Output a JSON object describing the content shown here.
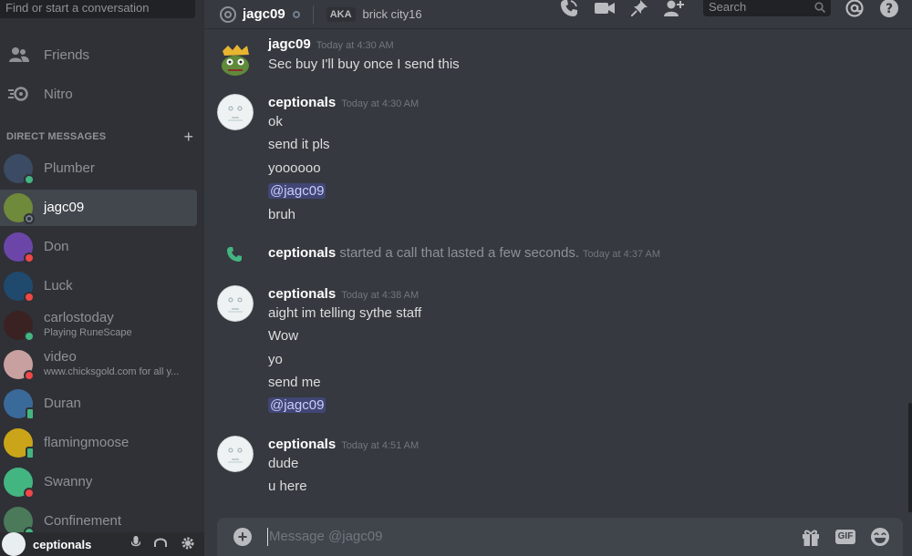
{
  "sidebar": {
    "search_placeholder": "Find or start a conversation",
    "nav": [
      {
        "label": "Friends",
        "icon": "friends-icon"
      },
      {
        "label": "Nitro",
        "icon": "nitro-icon"
      }
    ],
    "dm_header": "DIRECT MESSAGES",
    "dm_add_icon": "plus-icon",
    "dms": [
      {
        "name": "Plumber",
        "sub": "",
        "status": "online",
        "avatar_color": "#3b4b63",
        "active": false
      },
      {
        "name": "jagc09",
        "sub": "",
        "status": "offline",
        "avatar_color": "#6e8a3a",
        "active": true
      },
      {
        "name": "Don",
        "sub": "",
        "status": "dnd",
        "avatar_color": "#6b46a8",
        "active": false
      },
      {
        "name": "Luck",
        "sub": "",
        "status": "dnd",
        "avatar_color": "#1f4a6e",
        "active": false
      },
      {
        "name": "carlostoday",
        "sub": "Playing RuneScape",
        "status": "online",
        "avatar_color": "#3a2222",
        "active": false
      },
      {
        "name": "video",
        "sub": "www.chicksgold.com for all y...",
        "status": "dnd",
        "avatar_color": "#c9a0a0",
        "active": false
      },
      {
        "name": "Duran",
        "sub": "",
        "status": "mobile",
        "avatar_color": "#3a6a9a",
        "active": false
      },
      {
        "name": "flamingmoose",
        "sub": "",
        "status": "mobile",
        "avatar_color": "#caa51a",
        "active": false
      },
      {
        "name": "Swanny",
        "sub": "",
        "status": "dnd",
        "avatar_color": "#43b581",
        "active": false
      },
      {
        "name": "Confinement",
        "sub": "",
        "status": "online",
        "avatar_color": "#4a7a5a",
        "active": false
      }
    ],
    "user_panel": {
      "username": "ceptionals"
    }
  },
  "header": {
    "channel_name": "jagc09",
    "aka_label": "AKA",
    "aka_name": "brick city16",
    "search_placeholder": "Search"
  },
  "messages": {
    "groups": [
      {
        "author": "jagc09",
        "timestamp": "Today at 4:30 AM",
        "lines": [
          "Sec buy I'll buy once I send this"
        ]
      },
      {
        "author": "ceptionals",
        "timestamp": "Today at 4:30 AM",
        "lines": [
          "ok",
          "send it pls",
          "yoooooo",
          "@jagc09",
          "bruh"
        ]
      },
      {
        "author": "ceptionals",
        "timestamp": "Today at 4:38 AM",
        "lines": [
          "aight im telling sythe staff",
          "Wow",
          "yo",
          "send me",
          "@jagc09"
        ]
      },
      {
        "author": "ceptionals",
        "timestamp": "Today at 4:51 AM",
        "lines": [
          "dude",
          "u here"
        ]
      }
    ],
    "call": {
      "author": "ceptionals",
      "text": "started a call that lasted a few seconds.",
      "timestamp": "Today at 4:37 AM"
    }
  },
  "composer": {
    "placeholder": "Message @jagc09",
    "gif_label": "GIF"
  },
  "colors": {
    "online": "#43b581",
    "dnd": "#f04747",
    "offline": "#747f8d",
    "mention_bg": "#414675",
    "accent": "#7289da"
  }
}
